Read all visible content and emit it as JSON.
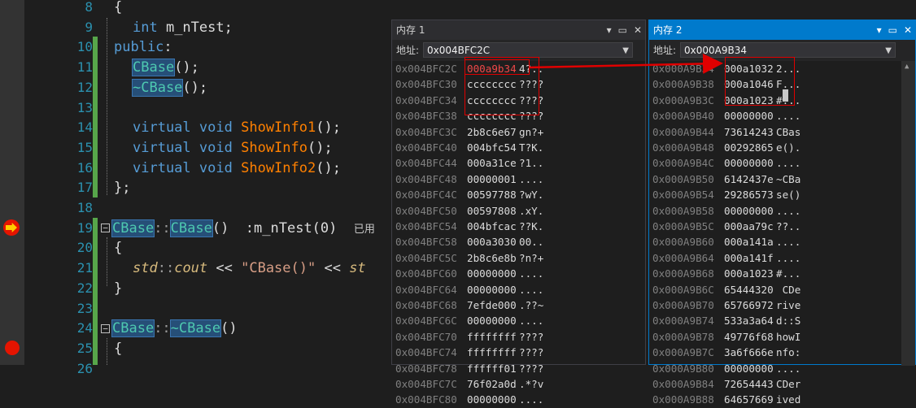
{
  "editor": {
    "line_numbers": [
      "8",
      "9",
      "10",
      "11",
      "12",
      "13",
      "14",
      "15",
      "16",
      "17",
      "18",
      "19",
      "20",
      "21",
      "22",
      "23",
      "24",
      "25",
      "26"
    ],
    "lines": {
      "l8": "{",
      "l9_kw": "int",
      "l9_rest": " m_nTest;",
      "l10_kw": "public",
      "l10_colon": ":",
      "l11_name": "CBase",
      "l11_rest": "();",
      "l12_name": "~CBase",
      "l12_rest": "();",
      "l14_kw1": "virtual",
      "l14_kw2": "void",
      "l14_fn": "ShowInfo1",
      "l14_rest": "();",
      "l15_kw1": "virtual",
      "l15_kw2": "void",
      "l15_fn": "ShowInfo",
      "l15_rest": "();",
      "l16_kw1": "virtual",
      "l16_kw2": "void",
      "l16_fn": "ShowInfo2",
      "l16_rest": "();",
      "l17": "};",
      "l19_cls": "CBase",
      "l19_sep": "::",
      "l19_ctor": "CBase",
      "l19_rest": "()  :m_nTest(0)",
      "l19_note": "已用",
      "l20": "{",
      "l21_std": "std",
      "l21_sep": "::",
      "l21_cout": "cout",
      "l21_op": " << ",
      "l21_str": "\"CBase()\"",
      "l21_op2": " << ",
      "l21_trail": "st",
      "l22": "}",
      "l24_cls": "CBase",
      "l24_sep": "::",
      "l24_dtor": "~CBase",
      "l24_rest": "()",
      "l25": "{"
    }
  },
  "memory1": {
    "title": "内存 1",
    "address_label": "地址:",
    "address_value": "0x004BFC2C",
    "rows": [
      {
        "addr": "0x004BFC2C",
        "val": "000a9b34",
        "txt": "4?..",
        "changed": true
      },
      {
        "addr": "0x004BFC30",
        "val": "cccccccc",
        "txt": "????"
      },
      {
        "addr": "0x004BFC34",
        "val": "cccccccc",
        "txt": "????"
      },
      {
        "addr": "0x004BFC38",
        "val": "cccccccc",
        "txt": "????"
      },
      {
        "addr": "0x004BFC3C",
        "val": "2b8c6e67",
        "txt": "gn?+"
      },
      {
        "addr": "0x004BFC40",
        "val": "004bfc54",
        "txt": "T?K."
      },
      {
        "addr": "0x004BFC44",
        "val": "000a31ce",
        "txt": "?1.."
      },
      {
        "addr": "0x004BFC48",
        "val": "00000001",
        "txt": "...."
      },
      {
        "addr": "0x004BFC4C",
        "val": "00597788",
        "txt": "?wY."
      },
      {
        "addr": "0x004BFC50",
        "val": "00597808",
        "txt": ".xY."
      },
      {
        "addr": "0x004BFC54",
        "val": "004bfcac",
        "txt": "??K."
      },
      {
        "addr": "0x004BFC58",
        "val": "000a3030",
        "txt": "00.."
      },
      {
        "addr": "0x004BFC5C",
        "val": "2b8c6e8b",
        "txt": "?n?+"
      },
      {
        "addr": "0x004BFC60",
        "val": "00000000",
        "txt": "...."
      },
      {
        "addr": "0x004BFC64",
        "val": "00000000",
        "txt": "...."
      },
      {
        "addr": "0x004BFC68",
        "val": "7efde000",
        "txt": ".??~"
      },
      {
        "addr": "0x004BFC6C",
        "val": "00000000",
        "txt": "...."
      },
      {
        "addr": "0x004BFC70",
        "val": "ffffffff",
        "txt": "????"
      },
      {
        "addr": "0x004BFC74",
        "val": "ffffffff",
        "txt": "????"
      },
      {
        "addr": "0x004BFC78",
        "val": "ffffff01",
        "txt": "????"
      },
      {
        "addr": "0x004BFC7C",
        "val": "76f02a0d",
        "txt": ".*?v"
      },
      {
        "addr": "0x004BFC80",
        "val": "00000000",
        "txt": "...."
      }
    ]
  },
  "memory2": {
    "title": "内存 2",
    "address_label": "地址:",
    "address_value": "0x000A9B34",
    "rows": [
      {
        "addr": "0x000A9B34",
        "val": "000a1032",
        "txt": "2..."
      },
      {
        "addr": "0x000A9B38",
        "val": "000a1046",
        "txt": "F..."
      },
      {
        "addr": "0x000A9B3C",
        "val": "000a1023",
        "txt": "#..."
      },
      {
        "addr": "0x000A9B40",
        "val": "00000000",
        "txt": "...."
      },
      {
        "addr": "0x000A9B44",
        "val": "73614243",
        "txt": "CBas"
      },
      {
        "addr": "0x000A9B48",
        "val": "00292865",
        "txt": "e()."
      },
      {
        "addr": "0x000A9B4C",
        "val": "00000000",
        "txt": "...."
      },
      {
        "addr": "0x000A9B50",
        "val": "6142437e",
        "txt": "~CBa"
      },
      {
        "addr": "0x000A9B54",
        "val": "29286573",
        "txt": "se()"
      },
      {
        "addr": "0x000A9B58",
        "val": "00000000",
        "txt": "...."
      },
      {
        "addr": "0x000A9B5C",
        "val": "000aa79c",
        "txt": "??.."
      },
      {
        "addr": "0x000A9B60",
        "val": "000a141a",
        "txt": "...."
      },
      {
        "addr": "0x000A9B64",
        "val": "000a141f",
        "txt": "...."
      },
      {
        "addr": "0x000A9B68",
        "val": "000a1023",
        "txt": "#..."
      },
      {
        "addr": "0x000A9B6C",
        "val": "65444320",
        "txt": " CDe"
      },
      {
        "addr": "0x000A9B70",
        "val": "65766972",
        "txt": "rive"
      },
      {
        "addr": "0x000A9B74",
        "val": "533a3a64",
        "txt": "d::S"
      },
      {
        "addr": "0x000A9B78",
        "val": "49776f68",
        "txt": "howI"
      },
      {
        "addr": "0x000A9B7C",
        "val": "3a6f666e",
        "txt": "nfo:"
      },
      {
        "addr": "0x000A9B80",
        "val": "00000000",
        "txt": "...."
      },
      {
        "addr": "0x000A9B84",
        "val": "72654443",
        "txt": "CDer"
      },
      {
        "addr": "0x000A9B88",
        "val": "64657669",
        "txt": "ived"
      }
    ]
  },
  "colors": {
    "accent": "#007acc",
    "breakpoint": "#e51400",
    "annotation": "#e00000"
  }
}
